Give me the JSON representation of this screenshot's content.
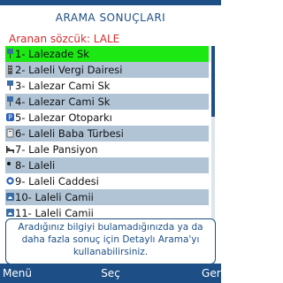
{
  "header": {
    "title": "ARAMA SONUÇLARI",
    "query_label": "Aranan sözcük: LALE"
  },
  "results": {
    "selected_index": 0,
    "items": [
      {
        "label": "1- Lalezade Sk",
        "icon": "street-icon"
      },
      {
        "label": "2- Laleli Vergi Dairesi",
        "icon": "building-icon"
      },
      {
        "label": "3- Lalezar Cami Sk",
        "icon": "street-icon"
      },
      {
        "label": "4- Lalezar Cami Sk",
        "icon": "street-icon"
      },
      {
        "label": "5- Lalezar Otoparkı",
        "icon": "parking-icon"
      },
      {
        "label": "6- Laleli Baba Türbesi",
        "icon": "tomb-icon"
      },
      {
        "label": "7- Lale Pansiyon",
        "icon": "bed-icon"
      },
      {
        "label": "8- Laleli",
        "icon": "location-dot-icon"
      },
      {
        "label": "9- Laleli Caddesi",
        "icon": "road-sign-icon"
      },
      {
        "label": "10- Laleli Camii",
        "icon": "mosque-icon"
      },
      {
        "label": "11- Laleli Camii",
        "icon": "mosque-icon"
      }
    ],
    "scroll_position": 0.0
  },
  "info_box": {
    "text": "Aradığınız bilgiyi bulamadığınızda ya da daha fazla sonuç için Detaylı Arama'yı kullanabilirsiniz."
  },
  "softkeys": {
    "left": "Menü",
    "center": "Seç",
    "right": "Geri"
  },
  "colors": {
    "accent": "#1d4f86",
    "query_text": "#d42b2b",
    "row_alt": "#b0c4d6",
    "row_selected": "#1ce814"
  }
}
